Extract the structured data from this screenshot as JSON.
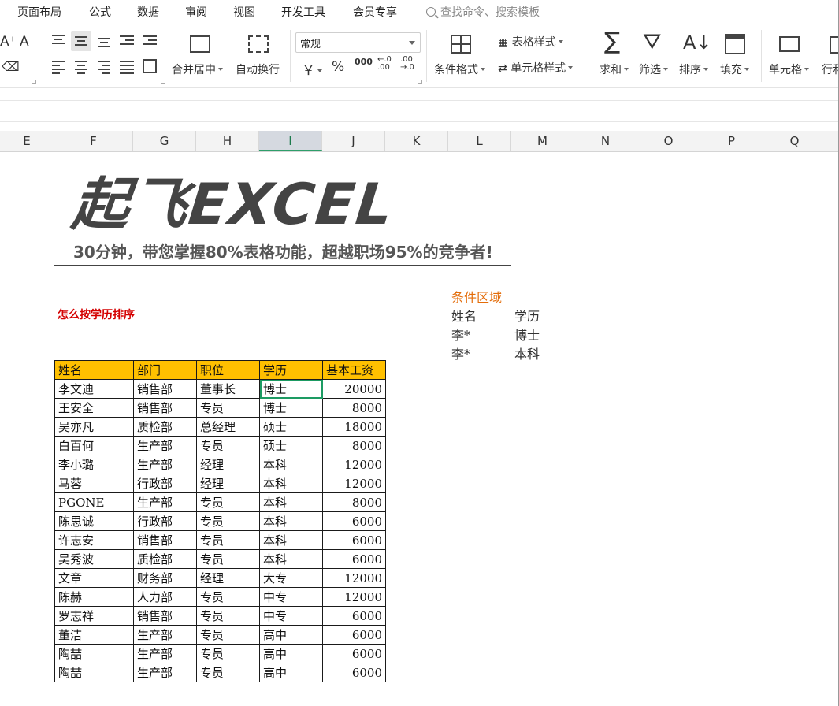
{
  "menu": {
    "items": [
      "页面布局",
      "公式",
      "数据",
      "审阅",
      "视图",
      "开发工具",
      "会员专享"
    ],
    "search_placeholder": "查找命令、搜索模板"
  },
  "ribbon": {
    "merge_label": "合并居中",
    "wrap_label": "自动换行",
    "number_format": "常规",
    "currency_symbol": "￥",
    "percent_symbol": "%",
    "thousands_symbol": "000",
    "cond_format_label": "条件格式",
    "table_style_label": "表格样式",
    "cell_style_label": "单元格样式",
    "sum_label": "求和",
    "filter_label": "筛选",
    "sort_label": "排序",
    "fill_label": "填充",
    "cell_label": "单元格",
    "row_col_label": "行和"
  },
  "columns": [
    {
      "label": "E",
      "active": false
    },
    {
      "label": "F",
      "active": false
    },
    {
      "label": "G",
      "active": false
    },
    {
      "label": "H",
      "active": false
    },
    {
      "label": "I",
      "active": true
    },
    {
      "label": "J",
      "active": false
    },
    {
      "label": "K",
      "active": false
    },
    {
      "label": "L",
      "active": false
    },
    {
      "label": "M",
      "active": false
    },
    {
      "label": "N",
      "active": false
    },
    {
      "label": "O",
      "active": false
    },
    {
      "label": "P",
      "active": false
    },
    {
      "label": "Q",
      "active": false
    }
  ],
  "banner": {
    "title": "起飞EXCEL",
    "subtitle": "30分钟，带您掌握80%表格功能，超越职场95%的竞争者!"
  },
  "task_title": "怎么按学历排序",
  "criteria": {
    "title": "条件区域",
    "headers": [
      "姓名",
      "学历"
    ],
    "rows": [
      [
        "李*",
        "博士"
      ],
      [
        "李*",
        "本科"
      ]
    ]
  },
  "table": {
    "headers": [
      "姓名",
      "部门",
      "职位",
      "学历",
      "基本工资"
    ],
    "rows": [
      [
        "李文迪",
        "销售部",
        "董事长",
        "博士",
        "20000"
      ],
      [
        "王安全",
        "销售部",
        "专员",
        "博士",
        "8000"
      ],
      [
        "吴亦凡",
        "质检部",
        "总经理",
        "硕士",
        "18000"
      ],
      [
        "白百何",
        "生产部",
        "专员",
        "硕士",
        "8000"
      ],
      [
        "李小璐",
        "生产部",
        "经理",
        "本科",
        "12000"
      ],
      [
        "马蓉",
        "行政部",
        "经理",
        "本科",
        "12000"
      ],
      [
        "PGONE",
        "生产部",
        "专员",
        "本科",
        "8000"
      ],
      [
        "陈思诚",
        "行政部",
        "专员",
        "本科",
        "6000"
      ],
      [
        "许志安",
        "销售部",
        "专员",
        "本科",
        "6000"
      ],
      [
        "吴秀波",
        "质检部",
        "专员",
        "本科",
        "6000"
      ],
      [
        "文章",
        "财务部",
        "经理",
        "大专",
        "12000"
      ],
      [
        "陈赫",
        "人力部",
        "专员",
        "中专",
        "12000"
      ],
      [
        "罗志祥",
        "销售部",
        "专员",
        "中专",
        "6000"
      ],
      [
        "董洁",
        "生产部",
        "专员",
        "高中",
        "6000"
      ],
      [
        "陶喆",
        "生产部",
        "专员",
        "高中",
        "6000"
      ],
      [
        "陶喆",
        "生产部",
        "专员",
        "高中",
        "6000"
      ]
    ]
  }
}
